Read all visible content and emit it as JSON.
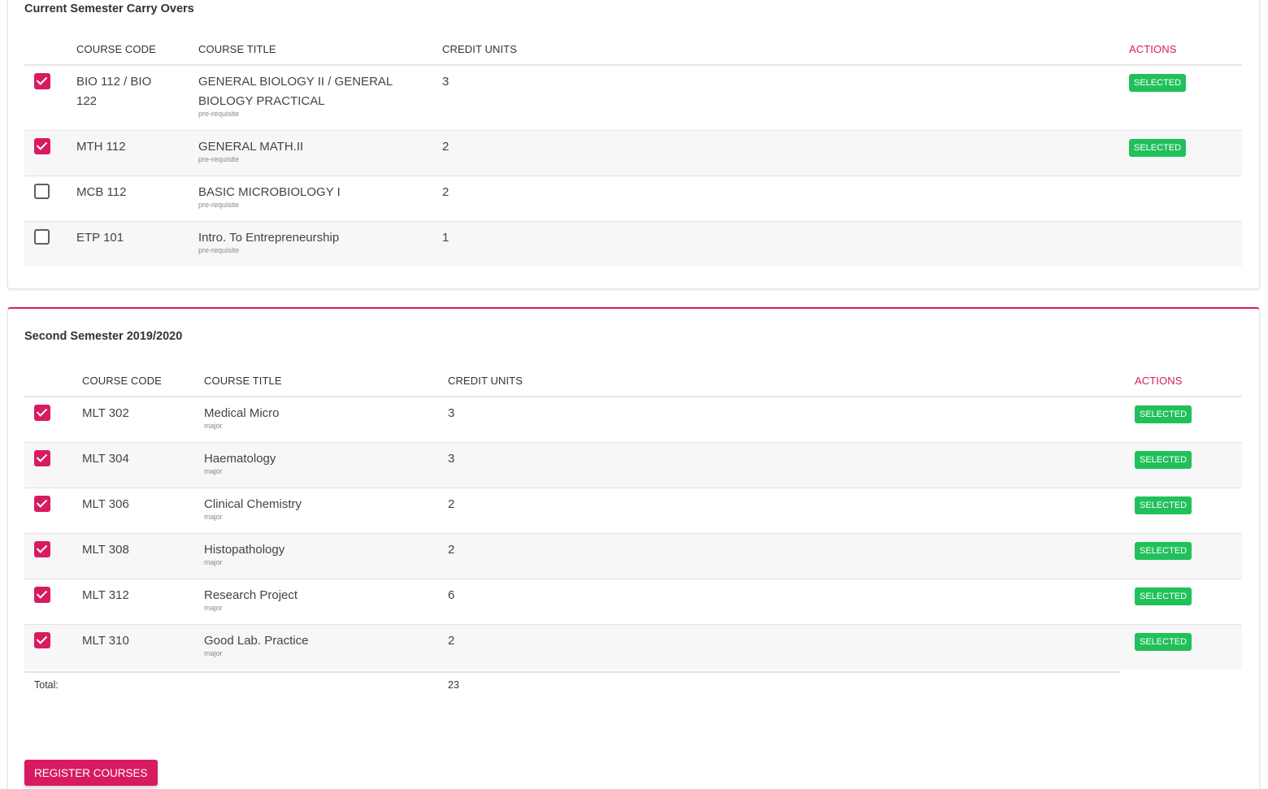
{
  "carry_overs": {
    "title": "Current Semester Carry Overs",
    "headers": {
      "code": "COURSE CODE",
      "title": "COURSE TITLE",
      "credit": "CREDIT UNITS",
      "actions": "ACTIONS"
    },
    "rows": [
      {
        "checked": true,
        "code_line1": "BIO 112 / BIO",
        "code_line2": "122",
        "title_line1": "GENERAL BIOLOGY II / GENERAL",
        "title_line2": "BIOLOGY PRACTICAL",
        "type": "pre-requisite",
        "credit": "3",
        "status": "SELECTED"
      },
      {
        "checked": true,
        "code_line1": "MTH 112",
        "code_line2": "",
        "title_line1": "GENERAL MATH.II",
        "title_line2": "",
        "type": "pre-requisite",
        "credit": "2",
        "status": "SELECTED"
      },
      {
        "checked": false,
        "code_line1": "MCB 112",
        "code_line2": "",
        "title_line1": "BASIC MICROBIOLOGY I",
        "title_line2": "",
        "type": "pre-requisite",
        "credit": "2",
        "status": ""
      },
      {
        "checked": false,
        "code_line1": "ETP 101",
        "code_line2": "",
        "title_line1": "Intro. To Entrepreneurship",
        "title_line2": "",
        "type": "pre-requisite",
        "credit": "1",
        "status": ""
      }
    ]
  },
  "second_semester": {
    "title": "Second Semester 2019/2020",
    "headers": {
      "code": "COURSE CODE",
      "title": "COURSE TITLE",
      "credit": "CREDIT UNITS",
      "actions": "ACTIONS"
    },
    "rows": [
      {
        "checked": true,
        "code": "MLT 302",
        "title": "Medical Micro",
        "type": "major",
        "credit": "3",
        "status": "SELECTED"
      },
      {
        "checked": true,
        "code": "MLT 304",
        "title": "Haematology",
        "type": "major",
        "credit": "3",
        "status": "SELECTED"
      },
      {
        "checked": true,
        "code": "MLT 306",
        "title": "Clinical Chemistry",
        "type": "major",
        "credit": "2",
        "status": "SELECTED"
      },
      {
        "checked": true,
        "code": "MLT 308",
        "title": "Histopathology",
        "type": "major",
        "credit": "2",
        "status": "SELECTED"
      },
      {
        "checked": true,
        "code": "MLT 312",
        "title": "Research Project",
        "type": "major",
        "credit": "6",
        "status": "SELECTED"
      },
      {
        "checked": true,
        "code": "MLT 310",
        "title": "Good Lab. Practice",
        "type": "major",
        "credit": "2",
        "status": "SELECTED"
      }
    ],
    "total_label": "Total:",
    "total_value": "23"
  },
  "register_button": "REGISTER COURSES",
  "colors": {
    "accent": "#d81b60",
    "badge_green": "#21c05a"
  }
}
